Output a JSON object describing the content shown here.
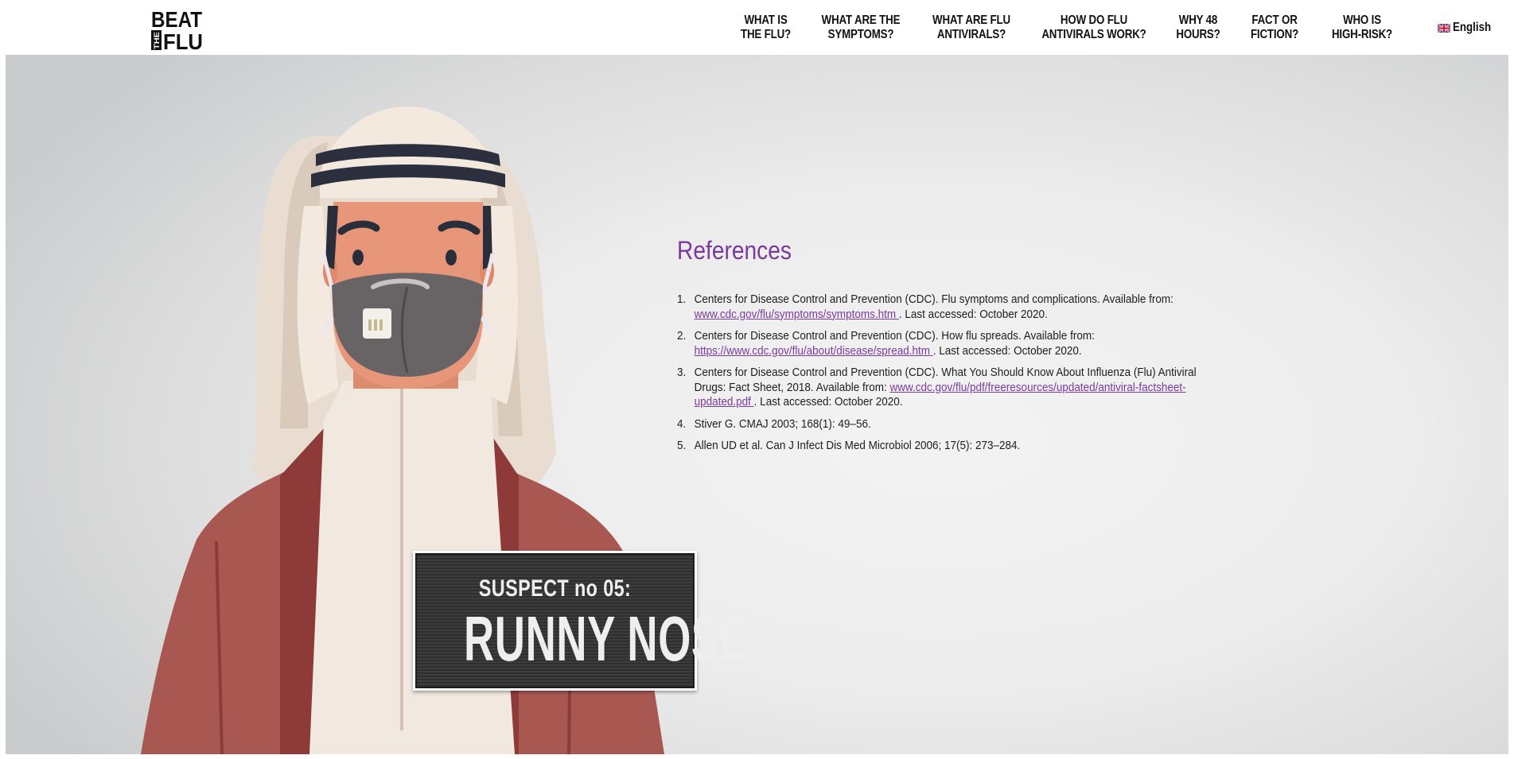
{
  "header": {
    "logo_text": "BEAT THE FLU",
    "nav": [
      {
        "line1": "WHAT IS",
        "line2": "THE FLU?"
      },
      {
        "line1": "WHAT ARE THE",
        "line2": "SYMPTOMS?"
      },
      {
        "line1": "WHAT ARE FLU",
        "line2": "ANTIVIRALS?"
      },
      {
        "line1": "HOW DO FLU",
        "line2": "ANTIVIRALS WORK?"
      },
      {
        "line1": "WHY 48",
        "line2": "HOURS?"
      },
      {
        "line1": "FACT OR",
        "line2": "FICTION?"
      },
      {
        "line1": "WHO IS",
        "line2": "HIGH-RISK?"
      }
    ],
    "language": {
      "label": "English",
      "flag_icon": "uk-flag-icon"
    }
  },
  "references": {
    "title": "References",
    "items": [
      {
        "num": "1.",
        "text_before": " Centers for Disease Control and Prevention (CDC). Flu symptoms and complications. Available from: ",
        "link": "www.cdc.gov/flu/symptoms/symptoms.htm ",
        "text_after": ". Last accessed: October 2020."
      },
      {
        "num": "2.",
        "text_before": " Centers for Disease Control and Prevention (CDC). How flu spreads. Available from: ",
        "link": "https://www.cdc.gov/flu/about/disease/spread.htm ",
        "text_after": ". Last accessed: October 2020."
      },
      {
        "num": "3.",
        "text_before": " Centers for Disease Control and Prevention (CDC). What You Should Know About Influenza (Flu) Antiviral Drugs: Fact Sheet, 2018. Available from: ",
        "link": "www.cdc.gov/flu/pdf/freeresources/updated/antiviral-factsheet-updated.pdf ",
        "text_after": ". Last accessed: October 2020."
      },
      {
        "num": "4.",
        "text_before": "Stiver G. CMAJ 2003; 168(1): 49–56.",
        "link": "",
        "text_after": ""
      },
      {
        "num": "5.",
        "text_before": " Allen UD et al. Can J Infect Dis Med Microbiol 2006; 17(5): 273–284.",
        "link": "",
        "text_after": ""
      }
    ]
  },
  "sign": {
    "line1": "SUSPECT no 05:",
    "line2": "RUNNY NOSE"
  },
  "colors": {
    "accent": "#7a3a9c",
    "sign_board": "#353535",
    "robe": "#a85851"
  }
}
